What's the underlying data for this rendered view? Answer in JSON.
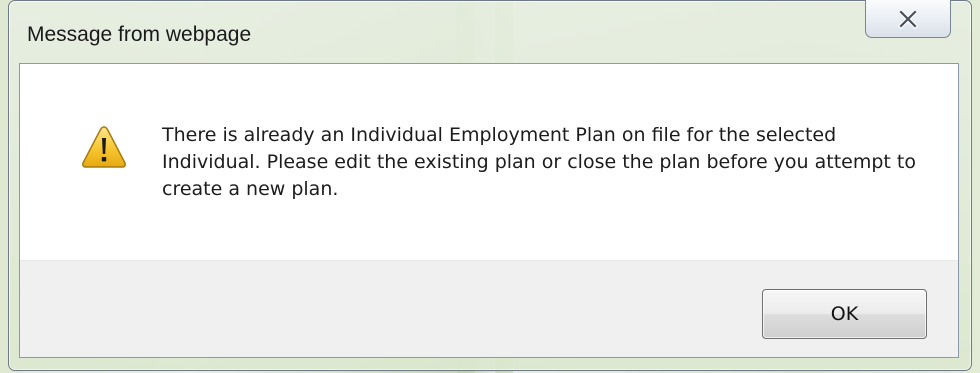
{
  "dialog": {
    "title": "Message from webpage",
    "close_icon": "close-icon",
    "warning_icon": "warning-triangle-icon",
    "message": "There is already an Individual Employment Plan on file for the selected Individual. Please edit the existing plan or close the plan before you attempt to create a new plan.",
    "ok_label": "OK"
  },
  "colors": {
    "warning_fill": "#f7c630",
    "background_accent": "#9fc46a",
    "footer_bg": "#f0f0f0"
  }
}
